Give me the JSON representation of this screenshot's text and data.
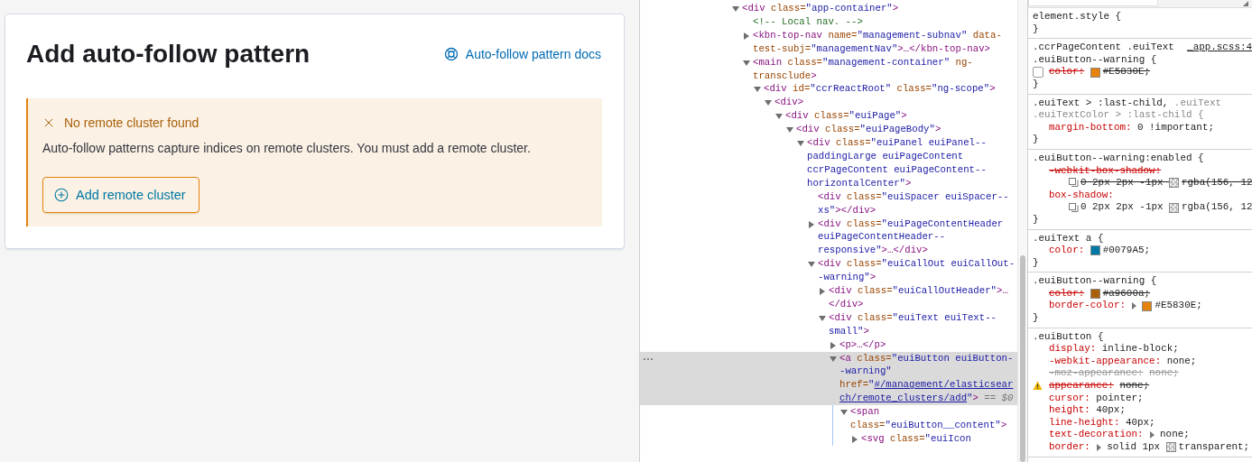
{
  "app": {
    "page_title": "Add auto-follow pattern",
    "docs_link": "Auto-follow pattern docs",
    "callout": {
      "title": "No remote cluster found",
      "body": "Auto-follow patterns capture indices on remote clusters. You must add a remote cluster.",
      "button": "Add remote cluster"
    }
  },
  "elements_panel": {
    "nodes": [
      {
        "kind": "expanded",
        "selected": false,
        "parts": [
          {
            "kind": "tag",
            "text": "<div "
          },
          {
            "kind": "attr",
            "text": "class="
          },
          {
            "kind": "value",
            "text": "\"app-container\""
          },
          {
            "kind": "tag",
            "text": ">"
          }
        ],
        "children": [
          {
            "kind": "leaf",
            "selected": false,
            "parts": [
              {
                "kind": "comment",
                "text": "<!-- Local nav. -->"
              }
            ]
          },
          {
            "kind": "collapsed",
            "selected": false,
            "parts": [
              {
                "kind": "tag",
                "text": "<kbn-top-nav "
              },
              {
                "kind": "attr",
                "text": "name="
              },
              {
                "kind": "value",
                "text": "\"management-subnav\" "
              },
              {
                "kind": "attr",
                "text": "data-test-subj="
              },
              {
                "kind": "value",
                "text": "\"managementNav\""
              },
              {
                "kind": "tag",
                "text": ">…</kbn-top-nav>"
              }
            ]
          },
          {
            "kind": "expanded",
            "selected": false,
            "parts": [
              {
                "kind": "tag",
                "text": "<main "
              },
              {
                "kind": "attr",
                "text": "class="
              },
              {
                "kind": "value",
                "text": "\"management-container\" "
              },
              {
                "kind": "attr",
                "text": "ng-transclude"
              },
              {
                "kind": "tag",
                "text": ">"
              }
            ],
            "children": [
              {
                "kind": "expanded",
                "selected": false,
                "parts": [
                  {
                    "kind": "tag",
                    "text": "<div "
                  },
                  {
                    "kind": "attr",
                    "text": "id="
                  },
                  {
                    "kind": "value",
                    "text": "\"ccrReactRoot\" "
                  },
                  {
                    "kind": "attr",
                    "text": "class="
                  },
                  {
                    "kind": "value",
                    "text": "\"ng-scope\""
                  },
                  {
                    "kind": "tag",
                    "text": ">"
                  }
                ],
                "children": [
                  {
                    "kind": "expanded",
                    "selected": false,
                    "parts": [
                      {
                        "kind": "tag",
                        "text": "<div>"
                      }
                    ],
                    "children": [
                      {
                        "kind": "expanded",
                        "selected": false,
                        "parts": [
                          {
                            "kind": "tag",
                            "text": "<div "
                          },
                          {
                            "kind": "attr",
                            "text": "class="
                          },
                          {
                            "kind": "value",
                            "text": "\"euiPage\""
                          },
                          {
                            "kind": "tag",
                            "text": ">"
                          }
                        ],
                        "children": [
                          {
                            "kind": "expanded",
                            "selected": false,
                            "parts": [
                              {
                                "kind": "tag",
                                "text": "<div "
                              },
                              {
                                "kind": "attr",
                                "text": "class="
                              },
                              {
                                "kind": "value",
                                "text": "\"euiPageBody\""
                              },
                              {
                                "kind": "tag",
                                "text": ">"
                              }
                            ],
                            "children": [
                              {
                                "kind": "expanded",
                                "selected": false,
                                "parts": [
                                  {
                                    "kind": "tag",
                                    "text": "<div "
                                  },
                                  {
                                    "kind": "attr",
                                    "text": "class="
                                  },
                                  {
                                    "kind": "value",
                                    "text": "\"euiPanel euiPanel--paddingLarge euiPageContent ccrPageContent euiPageContent--horizontalCenter\""
                                  },
                                  {
                                    "kind": "tag",
                                    "text": ">"
                                  }
                                ],
                                "children": [
                                  {
                                    "kind": "leaf",
                                    "selected": false,
                                    "parts": [
                                      {
                                        "kind": "tag",
                                        "text": "<div "
                                      },
                                      {
                                        "kind": "attr",
                                        "text": "class="
                                      },
                                      {
                                        "kind": "value",
                                        "text": "\"euiSpacer euiSpacer--xs\""
                                      },
                                      {
                                        "kind": "tag",
                                        "text": "></div>"
                                      }
                                    ]
                                  },
                                  {
                                    "kind": "collapsed",
                                    "selected": false,
                                    "parts": [
                                      {
                                        "kind": "tag",
                                        "text": "<div "
                                      },
                                      {
                                        "kind": "attr",
                                        "text": "class="
                                      },
                                      {
                                        "kind": "value",
                                        "text": "\"euiPageContentHeader euiPageContentHeader--responsive\""
                                      },
                                      {
                                        "kind": "tag",
                                        "text": ">…</div>"
                                      }
                                    ]
                                  },
                                  {
                                    "kind": "expanded",
                                    "selected": false,
                                    "parts": [
                                      {
                                        "kind": "tag",
                                        "text": "<div "
                                      },
                                      {
                                        "kind": "attr",
                                        "text": "class="
                                      },
                                      {
                                        "kind": "value",
                                        "text": "\"euiCallOut euiCallOut--warning\""
                                      },
                                      {
                                        "kind": "tag",
                                        "text": ">"
                                      }
                                    ],
                                    "children": [
                                      {
                                        "kind": "collapsed",
                                        "selected": false,
                                        "parts": [
                                          {
                                            "kind": "tag",
                                            "text": "<div "
                                          },
                                          {
                                            "kind": "attr",
                                            "text": "class="
                                          },
                                          {
                                            "kind": "value",
                                            "text": "\"euiCallOutHeader\""
                                          },
                                          {
                                            "kind": "tag",
                                            "text": ">…</div>"
                                          }
                                        ]
                                      },
                                      {
                                        "kind": "expanded",
                                        "selected": false,
                                        "parts": [
                                          {
                                            "kind": "tag",
                                            "text": "<div "
                                          },
                                          {
                                            "kind": "attr",
                                            "text": "class="
                                          },
                                          {
                                            "kind": "value",
                                            "text": "\"euiText euiText--small\""
                                          },
                                          {
                                            "kind": "tag",
                                            "text": ">"
                                          }
                                        ],
                                        "children": [
                                          {
                                            "kind": "collapsed",
                                            "selected": false,
                                            "parts": [
                                              {
                                                "kind": "tag",
                                                "text": "<p>…</p>"
                                              }
                                            ]
                                          },
                                          {
                                            "kind": "expanded",
                                            "selected": true,
                                            "parts": [
                                              {
                                                "kind": "tag",
                                                "text": "<a "
                                              },
                                              {
                                                "kind": "attr",
                                                "text": "class="
                                              },
                                              {
                                                "kind": "value",
                                                "text": "\"euiButton euiButton--warning\" "
                                              },
                                              {
                                                "kind": "attr",
                                                "text": "href="
                                              },
                                              {
                                                "kind": "value",
                                                "text": "\""
                                              },
                                              {
                                                "kind": "link",
                                                "text": "#/management/elasticsearch/remote_clusters/add"
                                              },
                                              {
                                                "kind": "value",
                                                "text": "\""
                                              },
                                              {
                                                "kind": "tag",
                                                "text": ">"
                                              },
                                              {
                                                "kind": "hint",
                                                "text": " == $0"
                                              }
                                            ],
                                            "children": [
                                              {
                                                "kind": "expanded",
                                                "selected": false,
                                                "parts": [
                                                  {
                                                    "kind": "tag",
                                                    "text": "<span "
                                                  },
                                                  {
                                                    "kind": "attr",
                                                    "text": "class="
                                                  },
                                                  {
                                                    "kind": "value",
                                                    "text": "\"euiButton__content\""
                                                  },
                                                  {
                                                    "kind": "tag",
                                                    "text": ">"
                                                  }
                                                ],
                                                "children": [
                                                  {
                                                    "kind": "collapsed",
                                                    "selected": false,
                                                    "parts": [
                                                      {
                                                        "kind": "tag",
                                                        "text": "<svg "
                                                      },
                                                      {
                                                        "kind": "attr",
                                                        "text": "class="
                                                      },
                                                      {
                                                        "kind": "value",
                                                        "text": "\"euiIcon"
                                                      }
                                                    ]
                                                  }
                                                ]
                                              }
                                            ]
                                          }
                                        ]
                                      }
                                    ]
                                  }
                                ]
                              }
                            ]
                          }
                        ]
                      }
                    ]
                  }
                ]
              }
            ]
          }
        ]
      }
    ]
  },
  "styles_panel": {
    "rules": [
      {
        "selector": [
          {
            "text": "element.style {",
            "matched": true
          }
        ],
        "close": "}"
      },
      {
        "selector": [
          {
            "text": ".ccrPageContent .euiText .euiButton--warning {",
            "matched": true
          }
        ],
        "source": "_app.scss:4",
        "declarations": [
          {
            "prop": "color:",
            "kind": "overridden",
            "checkbox": false,
            "value_parts": [
              {
                "kind": "swatch",
                "color": "#e5830e"
              },
              {
                "kind": "text",
                "text": "#E5830E;"
              }
            ]
          }
        ],
        "close": "}"
      },
      {
        "selector": [
          {
            "text": ".euiText > :last-child, ",
            "matched": true
          },
          {
            "text": ".euiText ",
            "matched": false
          },
          {
            "text": ".euiTextColor > :last-child {",
            "matched": false
          }
        ],
        "declarations": [
          {
            "prop": "margin-bottom:",
            "kind": "active",
            "value_parts": [
              {
                "kind": "text",
                "text": "0 !important;"
              }
            ]
          }
        ],
        "close": "}"
      },
      {
        "selector": [
          {
            "text": ".euiButton--warning:enabled {",
            "matched": true
          }
        ],
        "declarations": [
          {
            "prop": "-webkit-box-shadow:",
            "kind": "overridden",
            "value_parts": [
              {
                "kind": "shadow"
              },
              {
                "kind": "text",
                "text": "0 2px 2px -1px "
              },
              {
                "kind": "checker"
              },
              {
                "kind": "text",
                "text": "rgba(156, 12"
              }
            ]
          },
          {
            "prop": "box-shadow:",
            "kind": "active",
            "value_parts": [
              {
                "kind": "shadow"
              },
              {
                "kind": "text",
                "text": "0 2px 2px -1px "
              },
              {
                "kind": "checker"
              },
              {
                "kind": "text",
                "text": "rgba(156, 12"
              }
            ]
          }
        ],
        "close": "}"
      },
      {
        "selector": [
          {
            "text": ".euiText a {",
            "matched": true
          }
        ],
        "declarations": [
          {
            "prop": "color:",
            "kind": "active",
            "value_parts": [
              {
                "kind": "swatch",
                "color": "#0079a5"
              },
              {
                "kind": "text",
                "text": "#0079A5;"
              }
            ]
          }
        ],
        "close": "}"
      },
      {
        "selector": [
          {
            "text": ".euiButton--warning {",
            "matched": true
          }
        ],
        "declarations": [
          {
            "prop": "color:",
            "kind": "overridden",
            "value_parts": [
              {
                "kind": "swatch",
                "color": "#a9600a"
              },
              {
                "kind": "text",
                "text": "#a9600a;"
              }
            ]
          },
          {
            "prop": "border-color:",
            "kind": "active",
            "value_parts": [
              {
                "kind": "expander"
              },
              {
                "kind": "swatch",
                "color": "#e5830e"
              },
              {
                "kind": "text",
                "text": "#E5830E;"
              }
            ]
          }
        ],
        "close": "}"
      },
      {
        "selector": [
          {
            "text": ".euiButton {",
            "matched": true
          }
        ],
        "declarations": [
          {
            "prop": "display:",
            "kind": "active",
            "value_parts": [
              {
                "kind": "text",
                "text": "inline-block;"
              }
            ]
          },
          {
            "prop": "-webkit-appearance:",
            "kind": "active",
            "value_parts": [
              {
                "kind": "text",
                "text": "none;"
              }
            ]
          },
          {
            "prop": "-moz-appearance:",
            "kind": "invalid",
            "value_parts": [
              {
                "kind": "text",
                "text": "none;"
              }
            ]
          },
          {
            "prop": "appearance:",
            "kind": "overridden",
            "warning": true,
            "value_parts": [
              {
                "kind": "text",
                "text": "none;"
              }
            ]
          },
          {
            "prop": "cursor:",
            "kind": "active",
            "value_parts": [
              {
                "kind": "text",
                "text": "pointer;"
              }
            ]
          },
          {
            "prop": "height:",
            "kind": "active",
            "value_parts": [
              {
                "kind": "text",
                "text": "40px;"
              }
            ]
          },
          {
            "prop": "line-height:",
            "kind": "active",
            "value_parts": [
              {
                "kind": "text",
                "text": "40px;"
              }
            ]
          },
          {
            "prop": "text-decoration:",
            "kind": "active",
            "value_parts": [
              {
                "kind": "expander"
              },
              {
                "kind": "text",
                "text": "none;"
              }
            ]
          },
          {
            "prop": "border:",
            "kind": "active",
            "value_parts": [
              {
                "kind": "expander"
              },
              {
                "kind": "text",
                "text": "solid 1px "
              },
              {
                "kind": "checker"
              },
              {
                "kind": "text",
                "text": "transparent;"
              }
            ]
          }
        ]
      }
    ]
  }
}
